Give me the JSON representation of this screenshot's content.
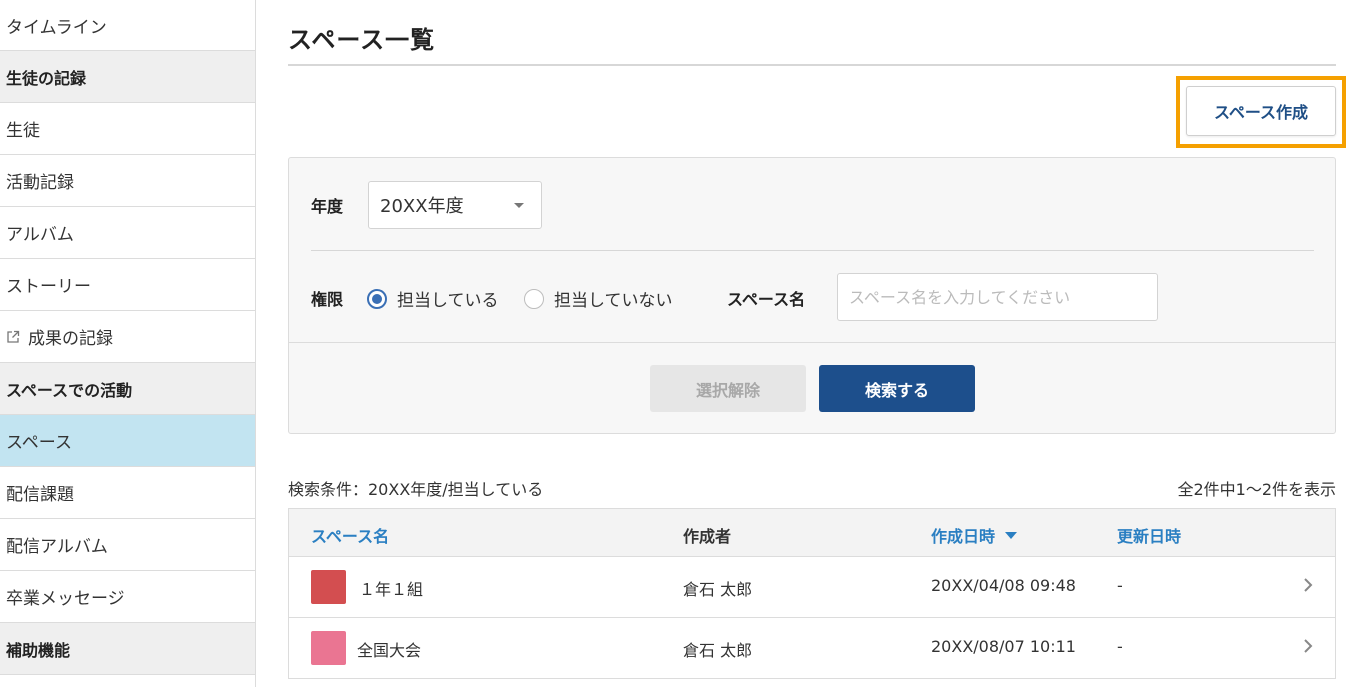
{
  "sidebar": {
    "items": [
      {
        "label": "タイムライン",
        "type": "link"
      },
      {
        "label": "生徒の記録",
        "type": "section"
      },
      {
        "label": "生徒",
        "type": "link"
      },
      {
        "label": "活動記録",
        "type": "link"
      },
      {
        "label": "アルバム",
        "type": "link"
      },
      {
        "label": "ストーリー",
        "type": "link"
      },
      {
        "label": "成果の記録",
        "type": "external-link",
        "icon": "external-link-icon"
      },
      {
        "label": "スペースでの活動",
        "type": "section"
      },
      {
        "label": "スペース",
        "type": "link",
        "active": true
      },
      {
        "label": "配信課題",
        "type": "link"
      },
      {
        "label": "配信アルバム",
        "type": "link"
      },
      {
        "label": "卒業メッセージ",
        "type": "link"
      },
      {
        "label": "補助機能",
        "type": "section"
      }
    ]
  },
  "page": {
    "title": "スペース一覧",
    "create_button": "スペース作成",
    "highlight_color": "#f5a000"
  },
  "filter": {
    "year_label": "年度",
    "year_value": "20XX年度",
    "permission_label": "権限",
    "radio_options": [
      {
        "label": "担当している",
        "selected": true
      },
      {
        "label": "担当していない",
        "selected": false
      }
    ],
    "space_name_label": "スペース名",
    "space_name_placeholder": "スペース名を入力してください",
    "space_name_value": "",
    "clear_button": "選択解除",
    "search_button": "検索する"
  },
  "results": {
    "condition": "検索条件：20XX年度/担当している",
    "count": "全2件中1～2件を表示"
  },
  "table": {
    "headers": {
      "name": "スペース名",
      "creator": "作成者",
      "created": "作成日時",
      "updated": "更新日時"
    },
    "rows": [
      {
        "color": "#d34e50",
        "name": "１年１組",
        "creator": "倉石 太郎",
        "created": "20XX/04/08 09:48",
        "updated": "-"
      },
      {
        "color": "#ea7592",
        "name": "全国大会",
        "creator": "倉石 太郎",
        "created": "20XX/08/07 10:11",
        "updated": "-"
      }
    ]
  }
}
